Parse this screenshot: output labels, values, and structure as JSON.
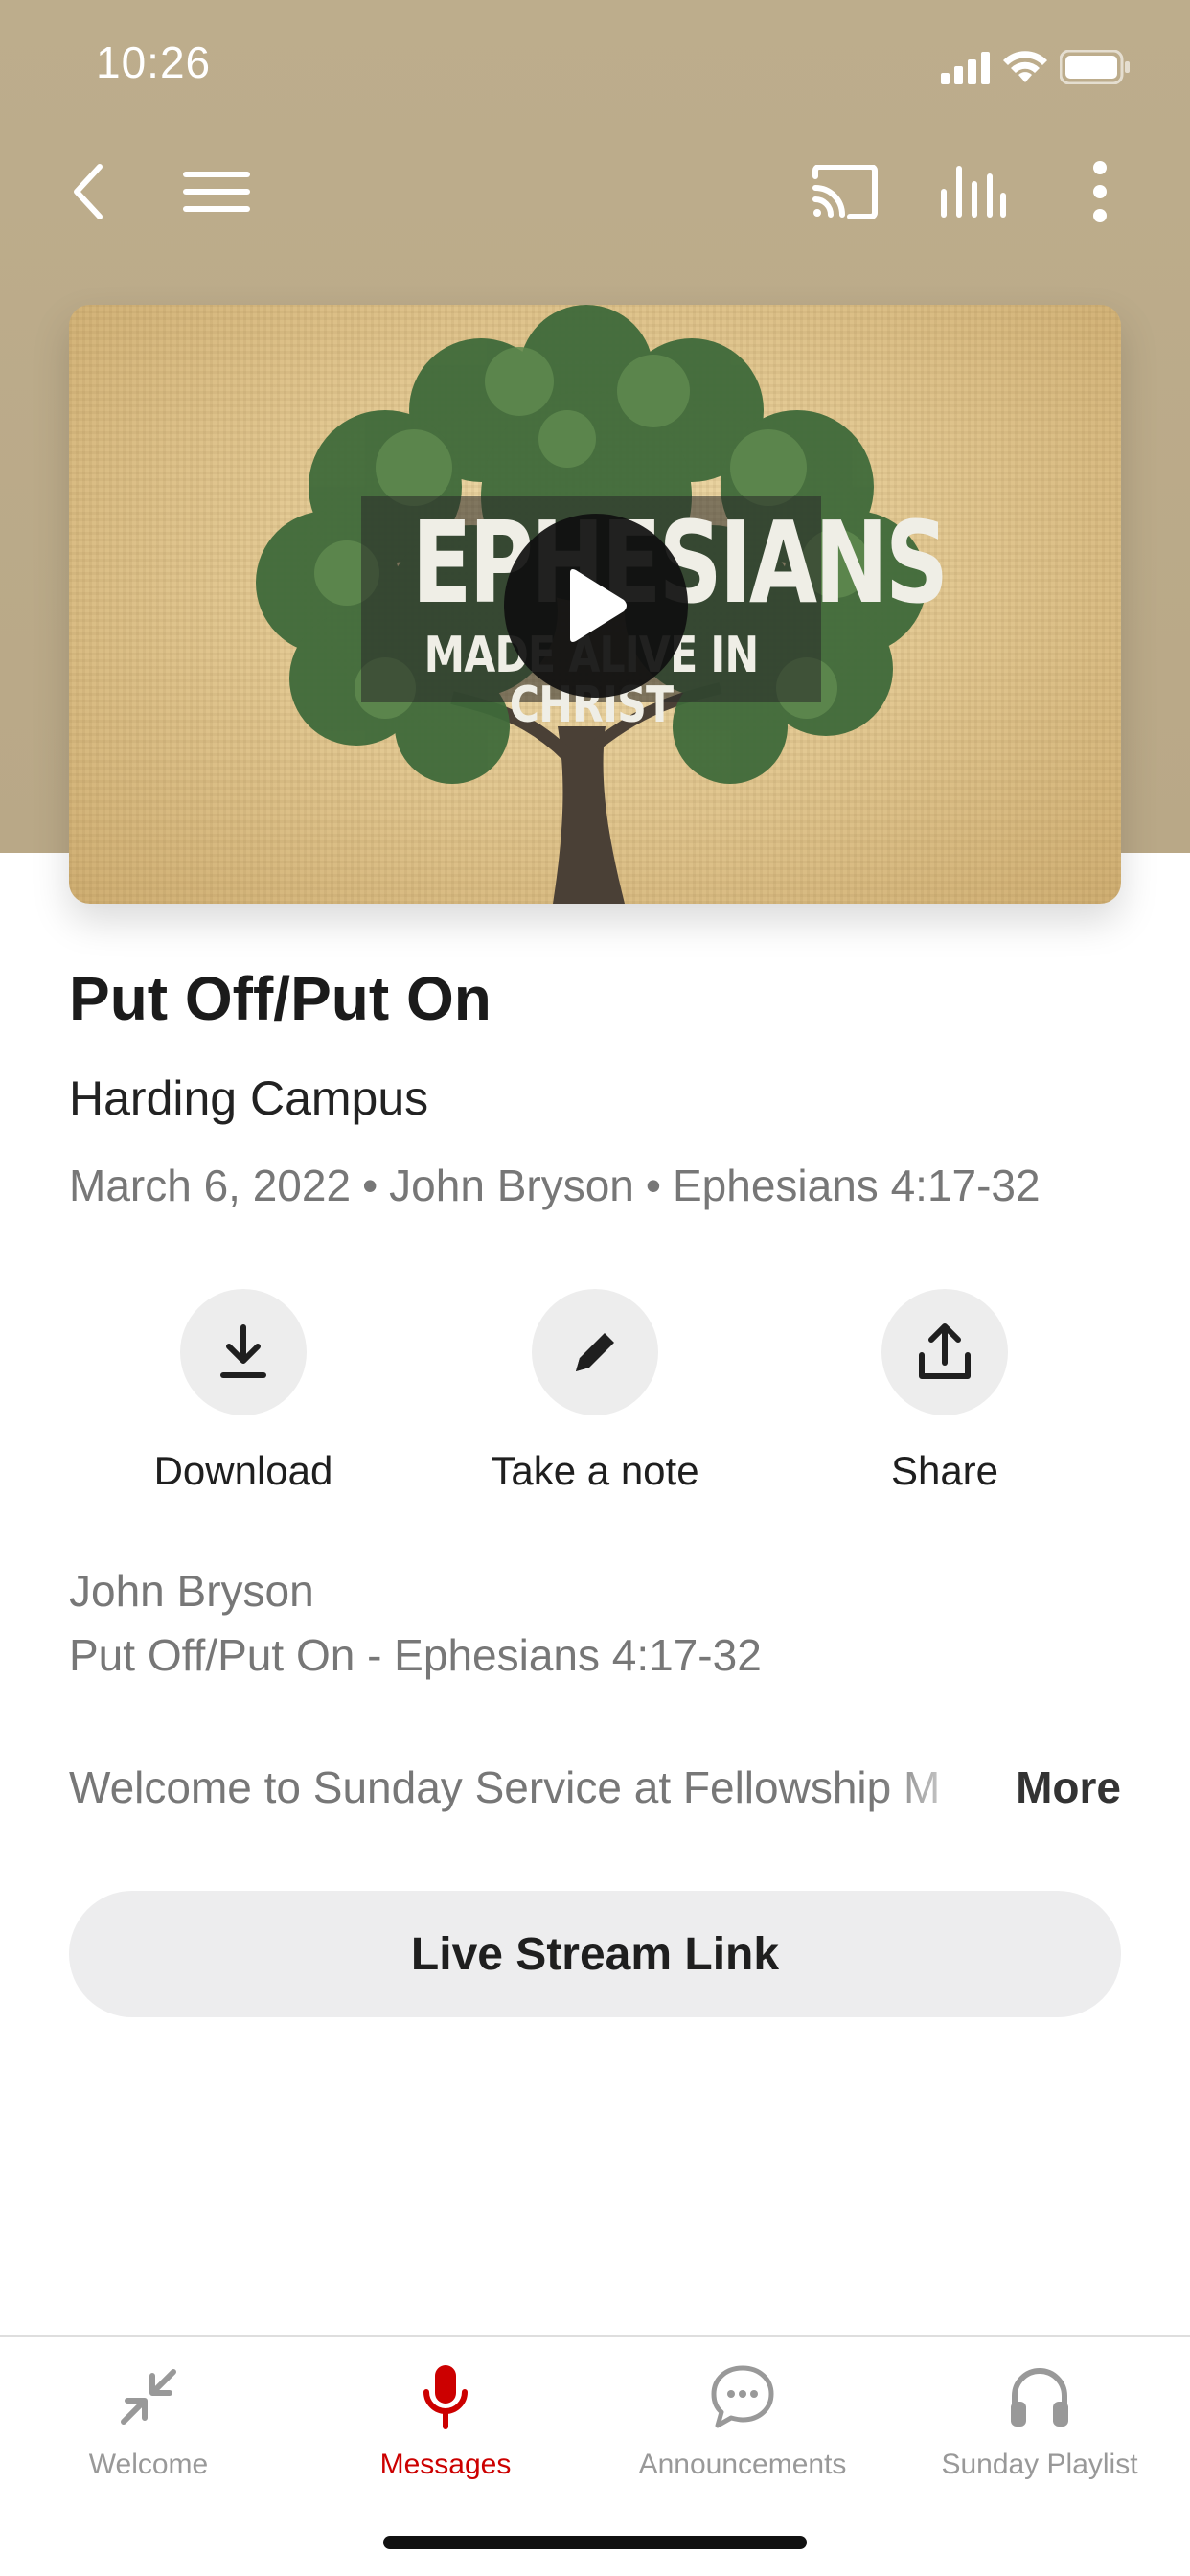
{
  "status_bar": {
    "time": "10:26",
    "icons": [
      "signal-icon",
      "wifi-icon",
      "battery-icon"
    ]
  },
  "nav": {
    "back_icon": "chevron-left-icon",
    "menu_icon": "hamburger-menu-icon",
    "cast_icon": "cast-icon",
    "audio_icon": "audio-bars-icon",
    "more_icon": "more-vertical-icon"
  },
  "artwork": {
    "title": "EPHESIANS",
    "subtitle": "MADE ALIVE IN CHRIST",
    "play_icon": "play-icon"
  },
  "message": {
    "title": "Put Off/Put On",
    "campus": "Harding Campus",
    "date": "March 6, 2022",
    "speaker": "John Bryson",
    "passage": "Ephesians 4:17-32",
    "separator": "•"
  },
  "actions": [
    {
      "label": "Download",
      "icon": "download-icon"
    },
    {
      "label": "Take a note",
      "icon": "pencil-icon"
    },
    {
      "label": "Share",
      "icon": "share-icon"
    }
  ],
  "description": {
    "line1": "John Bryson",
    "line2": "Put Off/Put On - Ephesians 4:17-32",
    "preview": "Welcome to Sunday Service at Fellowship M",
    "more_label": "More"
  },
  "live_stream_button": "Live Stream Link",
  "tabs": [
    {
      "label": "Welcome",
      "icon": "compress-arrows-icon",
      "active": false
    },
    {
      "label": "Messages",
      "icon": "microphone-icon",
      "active": true
    },
    {
      "label": "Announcements",
      "icon": "chat-bubble-icon",
      "active": false
    },
    {
      "label": "Sunday Playlist",
      "icon": "headphones-icon",
      "active": false
    }
  ],
  "colors": {
    "header": "#bdad8c",
    "active_tab": "#cc0000",
    "inactive_tab": "#999999"
  }
}
